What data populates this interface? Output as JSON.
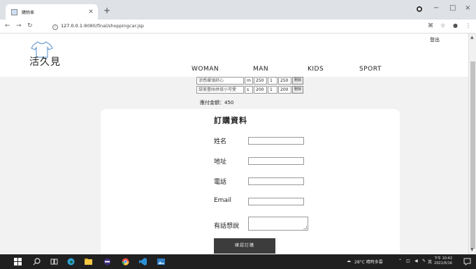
{
  "browser": {
    "tab_title": "購物車",
    "tab_close": "×",
    "new_tab": "+",
    "url_host": "127.0.0.1",
    "url_rest": ":8080/final/shoppingcar.jsp",
    "window_controls": [
      "−",
      "□",
      "×"
    ]
  },
  "header": {
    "logo_text": "活久見",
    "logout": "登出",
    "nav": [
      "WOMAN",
      "MAN",
      "KIDS",
      "SPORT"
    ]
  },
  "cart": {
    "rows": [
      {
        "name": "涼感膚領舒心",
        "size": "m",
        "price": "250",
        "qty": "1",
        "subtotal": "250",
        "action": "刪除"
      },
      {
        "name": "甜美蕾絲拼接小可愛",
        "size": "s",
        "price": "200",
        "qty": "1",
        "subtotal": "200",
        "action": "刪除"
      }
    ],
    "total_label": "應付金額：450"
  },
  "order_form": {
    "title": "訂購資料",
    "fields": [
      {
        "label": "姓名"
      },
      {
        "label": "地址"
      },
      {
        "label": "電話"
      },
      {
        "label": "Email"
      }
    ],
    "message_label": "有話想說",
    "submit_label": "確認訂購"
  },
  "taskbar": {
    "weather": "28°C 晴時多雲",
    "ime": "英",
    "time": "下午 10:42",
    "date": "2021/6/16"
  },
  "colors": {
    "page_bg": "#f2f2f2",
    "taskbar_bg": "#202020",
    "submit_bg": "#3c3c3c",
    "tabbar_bg": "#dee1e6"
  }
}
